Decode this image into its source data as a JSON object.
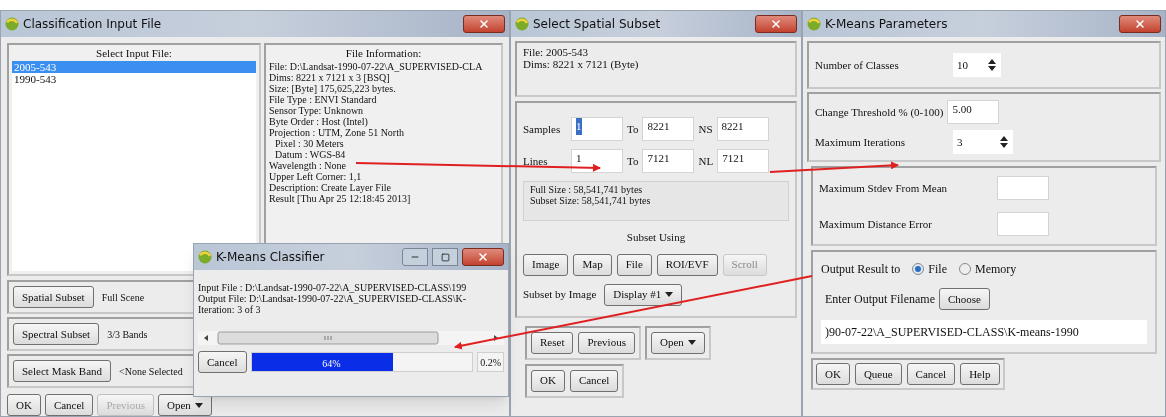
{
  "classification_input_file": {
    "title": "Classification Input File",
    "select_input_file": {
      "label": "Select Input File:",
      "items": [
        {
          "label": "2005-543",
          "selected": true
        },
        {
          "label": "1990-543",
          "selected": false
        }
      ]
    },
    "file_information": {
      "label": "File Information:",
      "lines": [
        {
          "text": "File: D:\\Landsat-1990-07-22\\A_SUPERVISED-CLA"
        },
        {
          "text": "Dims: 8221 x 7121 x 3 [BSQ]"
        },
        {
          "text": "Size: [Byte] 175,625,223 bytes."
        },
        {
          "text": "File Type : ENVI Standard"
        },
        {
          "text": "Sensor Type: Unknown"
        },
        {
          "text": "Byte Order : Host (Intel)"
        },
        {
          "text": "Projection : UTM, Zone 51 North",
          "children": [
            {
              "text": "Pixel : 30 Meters"
            },
            {
              "text": "Datum : WGS-84"
            }
          ]
        },
        {
          "text": "Wavelength : None"
        },
        {
          "text": "Upper Left Corner: 1,1"
        },
        {
          "text": "Description: Create Layer File"
        },
        {
          "text": "Result [Thu Apr 25 12:18:45 2013]"
        }
      ]
    },
    "rows": [
      {
        "button": "Spatial Subset",
        "value": "Full Scene"
      },
      {
        "button": "Spectral Subset",
        "value": "3/3 Bands"
      },
      {
        "button": "Select Mask Band",
        "value": "<None Selected"
      }
    ],
    "buttons": [
      {
        "label": "OK",
        "disabled": false,
        "kind": "plain"
      },
      {
        "label": "Cancel",
        "disabled": false,
        "kind": "plain"
      },
      {
        "label": "Previous",
        "disabled": true,
        "kind": "plain"
      },
      {
        "label": "Open",
        "disabled": false,
        "kind": "dropdown"
      }
    ]
  },
  "kmeans_classifier": {
    "title": "K-Means Classifier",
    "lines": [
      "Input File : D:\\Landsat-1990-07-22\\A_SUPERVISED-CLASS\\199",
      "Output File: D:\\Landsat-1990-07-22\\A_SUPERVISED-CLASS\\K-",
      "Iteration: 3 of 3"
    ],
    "cancel": "Cancel",
    "progress": {
      "level": 0.64,
      "label": "64%"
    },
    "rate": "0.2%"
  },
  "select_spatial_subset": {
    "title": "Select Spatial Subset",
    "info_lines": [
      "File: 2005-543",
      "Dims: 8221 x 7121 (Byte)"
    ],
    "ranges": [
      {
        "label": "Samples",
        "from": "1",
        "to_label": "To",
        "to": "8221",
        "count_label": "NS",
        "count": "8221",
        "selected": true
      },
      {
        "label": "Lines",
        "from": "1",
        "to_label": "To",
        "to": "7121",
        "count_label": "NL",
        "count": "7121",
        "selected": false
      }
    ],
    "size_lines": [
      "Full Size : 58,541,741 bytes",
      "Subset Size: 58,541,741 bytes"
    ],
    "subset_using": "Subset Using",
    "subset_buttons": [
      {
        "label": "Image",
        "disabled": false
      },
      {
        "label": "Map",
        "disabled": false
      },
      {
        "label": "File",
        "disabled": false
      },
      {
        "label": "ROI/EVF",
        "disabled": false
      },
      {
        "label": "Scroll",
        "disabled": true
      }
    ],
    "subset_by_image": {
      "label": "Subset by Image",
      "value": "Display #1"
    },
    "action_buttons": [
      {
        "label": "Reset",
        "kind": "plain"
      },
      {
        "label": "Previous",
        "kind": "plain"
      },
      {
        "label": "Open",
        "kind": "dropdown"
      }
    ],
    "dialog_buttons": [
      "OK",
      "Cancel"
    ]
  },
  "kmeans_parameters": {
    "title": "K-Means Parameters",
    "number_of_classes": {
      "label": "Number of Classes",
      "value": "10"
    },
    "change_threshold": {
      "label": "Change Threshold % (0-100)",
      "value": "5.00"
    },
    "maximum_iterations": {
      "label": "Maximum Iterations",
      "value": "3"
    },
    "maximum_stdev": {
      "label": "Maximum Stdev From Mean"
    },
    "maximum_distance_error": {
      "label": "Maximum Distance Error"
    },
    "output": {
      "label": "Output Result to",
      "options": [
        {
          "label": "File",
          "selected": true
        },
        {
          "label": "Memory",
          "selected": false
        }
      ]
    },
    "filename": {
      "label": "Enter Output Filename",
      "button": "Choose",
      "value": ")90-07-22\\A_SUPERVISED-CLASS\\K-means-1990"
    },
    "buttons": [
      "OK",
      "Queue",
      "Cancel",
      "Help"
    ]
  }
}
